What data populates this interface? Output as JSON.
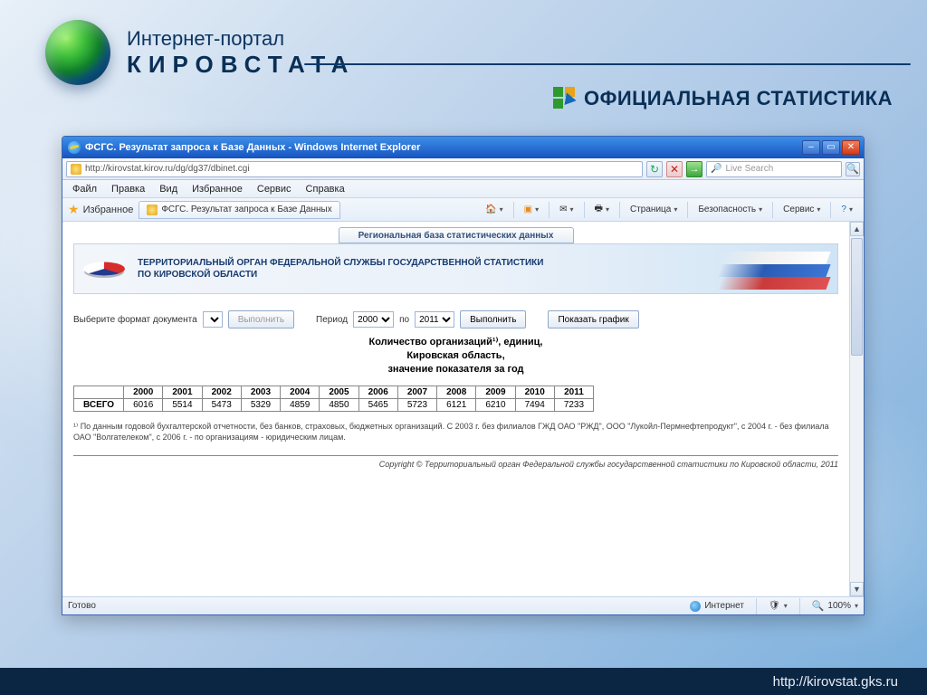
{
  "slide": {
    "title_line1": "Интернет-портал",
    "title_line2": "КИРОВСТАТА",
    "subtitle": "ОФИЦИАЛЬНАЯ СТАТИСТИКА",
    "footer_url": "http://kirovstat.gks.ru"
  },
  "browser": {
    "window_title": "ФСГС. Результат запроса к Базе Данных - Windows Internet Explorer",
    "address": "http://kirovstat.kirov.ru/dg/dg37/dbinet.cgi",
    "search_placeholder": "Live Search",
    "menus": [
      "Файл",
      "Правка",
      "Вид",
      "Избранное",
      "Сервис",
      "Справка"
    ],
    "favorites_label": "Избранное",
    "tab_label": "ФСГС. Результат запроса к Базе Данных",
    "toolbar_buttons": {
      "home": "",
      "feed": "",
      "mail": "",
      "print": "",
      "page": "Страница",
      "safety": "Безопасность",
      "tools": "Сервис",
      "help": ""
    },
    "status_ready": "Готово",
    "status_zone": "Интернет",
    "zoom": "100%"
  },
  "page": {
    "regional_tab": "Региональная база статистических данных",
    "banner_line1": "ТЕРРИТОРИАЛЬНЫЙ ОРГАН ФЕДЕРАЛЬНОЙ СЛУЖБЫ ГОСУДАРСТВЕННОЙ СТАТИСТИКИ",
    "banner_line2": "ПО КИРОВСКОЙ ОБЛАСТИ",
    "controls": {
      "format_label": "Выберите формат документа",
      "exec1": "Выполнить",
      "period_label": "Период",
      "period_from": "2000",
      "period_sep": "по",
      "period_to": "2011",
      "exec2": "Выполнить",
      "show_chart": "Показать график"
    },
    "data_title_l1": "Количество организаций¹⁾, единиц,",
    "data_title_l2": "Кировская область,",
    "data_title_l3": "значение показателя за год",
    "footnote": "¹⁾ По данным годовой бухгалтерской отчетности, без банков, страховых, бюджетных организаций. С 2003 г. без филиалов ГЖД ОАО \"РЖД\", ООО \"Лукойл-Пермнефтепродукт\", с 2004 г. - без филиала ОАО \"Волгателеком\", с 2006 г. - по организациям - юридическим лицам.",
    "copyright": "Copyright © Территориальный орган Федеральной службы государственной статистики по Кировской области, 2011"
  },
  "chart_data": {
    "type": "table",
    "title": "Количество организаций, единиц, Кировская область, значение показателя за год",
    "row_label": "ВСЕГО",
    "years": [
      "2000",
      "2001",
      "2002",
      "2003",
      "2004",
      "2005",
      "2006",
      "2007",
      "2008",
      "2009",
      "2010",
      "2011"
    ],
    "values": [
      6016,
      5514,
      5473,
      5329,
      4859,
      4850,
      5465,
      5723,
      6121,
      6210,
      7494,
      7233
    ]
  }
}
